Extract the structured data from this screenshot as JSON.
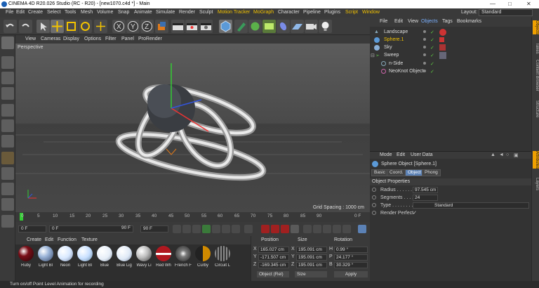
{
  "window": {
    "title": "CINEMA 4D R20.026 Studio (RC - R20) - [new1070.c4d *] - Main"
  },
  "menu": {
    "items": [
      "File",
      "Edit",
      "Create",
      "Select",
      "Tools",
      "Mesh",
      "Volume",
      "Snap",
      "Animate",
      "Simulate",
      "Render",
      "Sculpt",
      "Motion Tracker",
      "MoGraph",
      "Character",
      "Pipeline",
      "Plugins",
      "Script",
      "Window"
    ],
    "layout_label": "Layout:",
    "layout_value": "Standard"
  },
  "viewport": {
    "menu": [
      "View",
      "Cameras",
      "Display",
      "Options",
      "Filter",
      "Panel",
      "ProRender"
    ],
    "label": "Perspective",
    "grid_spacing": "Grid Spacing : 1000 cm"
  },
  "timeline": {
    "ticks": [
      "0",
      "5",
      "10",
      "15",
      "20",
      "25",
      "30",
      "35",
      "40",
      "45",
      "50",
      "55",
      "60",
      "65",
      "70",
      "75",
      "80",
      "85",
      "90"
    ],
    "end_label": "0 F"
  },
  "anim": {
    "start": "0 F",
    "current": "0 F",
    "preview_end": "90 F",
    "end": "90 F"
  },
  "materials": {
    "menu": [
      "Create",
      "Edit",
      "Function",
      "Texture"
    ],
    "items": [
      {
        "label": "Ruby",
        "color": "#7a0f18"
      },
      {
        "label": "Light Bl",
        "color": "#9bb4d8"
      },
      {
        "label": "Neon",
        "color": "#d8e8ff"
      },
      {
        "label": "Light Bl",
        "color": "#c8e0ff"
      },
      {
        "label": "Blue",
        "color": "#e6eef8"
      },
      {
        "label": "Blue Lig",
        "color": "#dfe9f6"
      },
      {
        "label": "Wavy Li",
        "color": "#bcbcbc"
      },
      {
        "label": "Red Wh",
        "color": "#b01820"
      },
      {
        "label": "French F",
        "color": "#7c7c7c"
      },
      {
        "label": "Curby",
        "color": "#d08a00"
      },
      {
        "label": "Circuit L",
        "color": "#8a8a8a"
      }
    ]
  },
  "coords": {
    "headers": [
      "Position",
      "Size",
      "Rotation"
    ],
    "rows": [
      {
        "axis": "X",
        "pos": "165.027 cm",
        "size_axis": "X",
        "size": "195.091 cm",
        "rot_axis": "H",
        "rot": "0.99 °"
      },
      {
        "axis": "Y",
        "pos": "-171.507 cm",
        "size_axis": "Y",
        "size": "195.091 cm",
        "rot_axis": "P",
        "rot": "24.177 °"
      },
      {
        "axis": "Z",
        "pos": "-169.345 cm",
        "size_axis": "Z",
        "size": "195.091 cm",
        "rot_axis": "B",
        "rot": "30.329 °"
      }
    ],
    "mode": "Object (Rel)",
    "size_mode": "Size",
    "apply": "Apply"
  },
  "objects": {
    "menu": [
      "File",
      "Edit",
      "View",
      "Objects",
      "Tags",
      "Bookmarks"
    ],
    "items": [
      {
        "name": "Landscape",
        "color": "#ddd",
        "indent": 0
      },
      {
        "name": "Sphere.1",
        "color": "#f2c200",
        "indent": 0
      },
      {
        "name": "Sky",
        "color": "#ddd",
        "indent": 0
      },
      {
        "name": "Sweep",
        "color": "#ddd",
        "indent": 0
      },
      {
        "name": "n-Side",
        "color": "#ddd",
        "indent": 1
      },
      {
        "name": "NeoKnot Object",
        "color": "#ddd",
        "indent": 1
      }
    ]
  },
  "attributes": {
    "menu": [
      "Mode",
      "Edit",
      "User Data"
    ],
    "title": "Sphere Object [Sphere.1]",
    "tabs": [
      "Basic",
      "Coord.",
      "Object",
      "Phong"
    ],
    "active_tab": "Object",
    "section": "Object Properties",
    "radius_label": "Radius . . . . . .",
    "radius": "97.545 cm",
    "segments_label": "Segments . . . .",
    "segments": "24",
    "type_label": "Type . . . . . . . .",
    "type": "Standard",
    "render_perfect_label": "Render Perfect",
    "render_perfect": "✓"
  },
  "right_tabs": [
    "Objects",
    "Takes",
    "Content Browser",
    "Structure",
    "Attributes",
    "Layers"
  ],
  "status": "Turn on/off Point Level Animation for recording",
  "colors": {
    "accent": "#f2c200",
    "selection": "#5b81b5",
    "bg": "#333333"
  }
}
